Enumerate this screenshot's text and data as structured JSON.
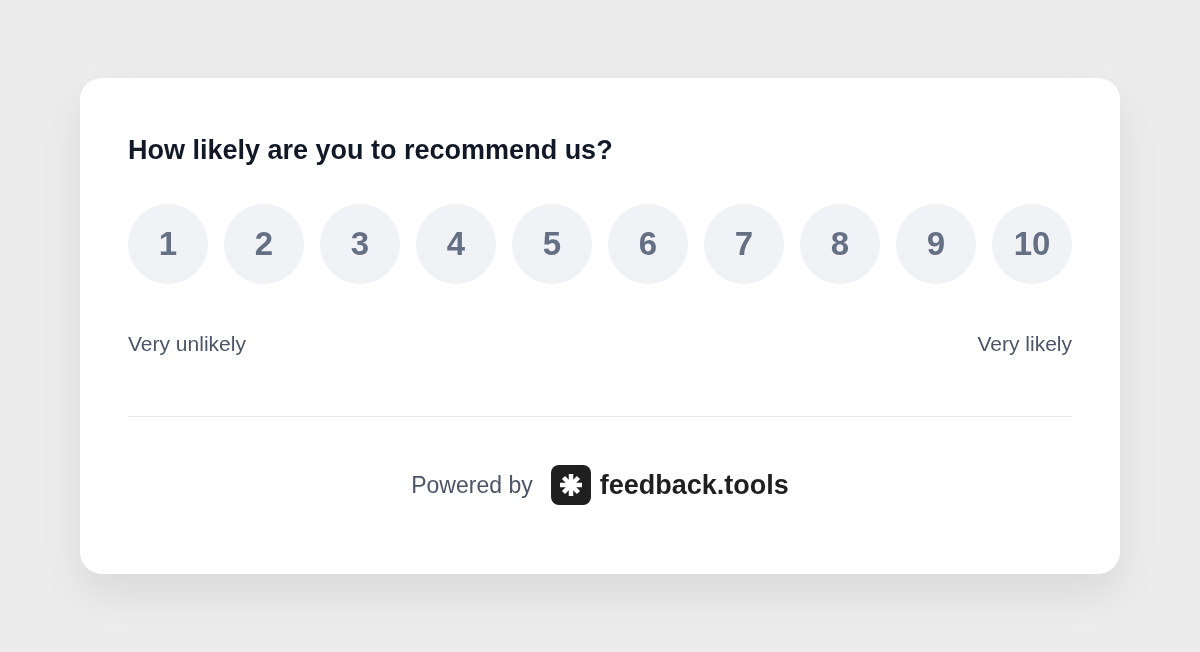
{
  "question": "How likely are you to recommend us?",
  "scores": [
    {
      "label": "1",
      "selected": false
    },
    {
      "label": "2",
      "selected": false
    },
    {
      "label": "3",
      "selected": false
    },
    {
      "label": "4",
      "selected": false
    },
    {
      "label": "5",
      "selected": false
    },
    {
      "label": "6",
      "selected": false
    },
    {
      "label": "7",
      "selected": false
    },
    {
      "label": "8",
      "selected": false
    },
    {
      "label": "9",
      "selected": false
    },
    {
      "label": "10",
      "selected": false
    }
  ],
  "scale_labels": {
    "low": "Very unlikely",
    "high": "Very likely"
  },
  "footer": {
    "prefix": "Powered by",
    "brand": "feedback.tools"
  }
}
